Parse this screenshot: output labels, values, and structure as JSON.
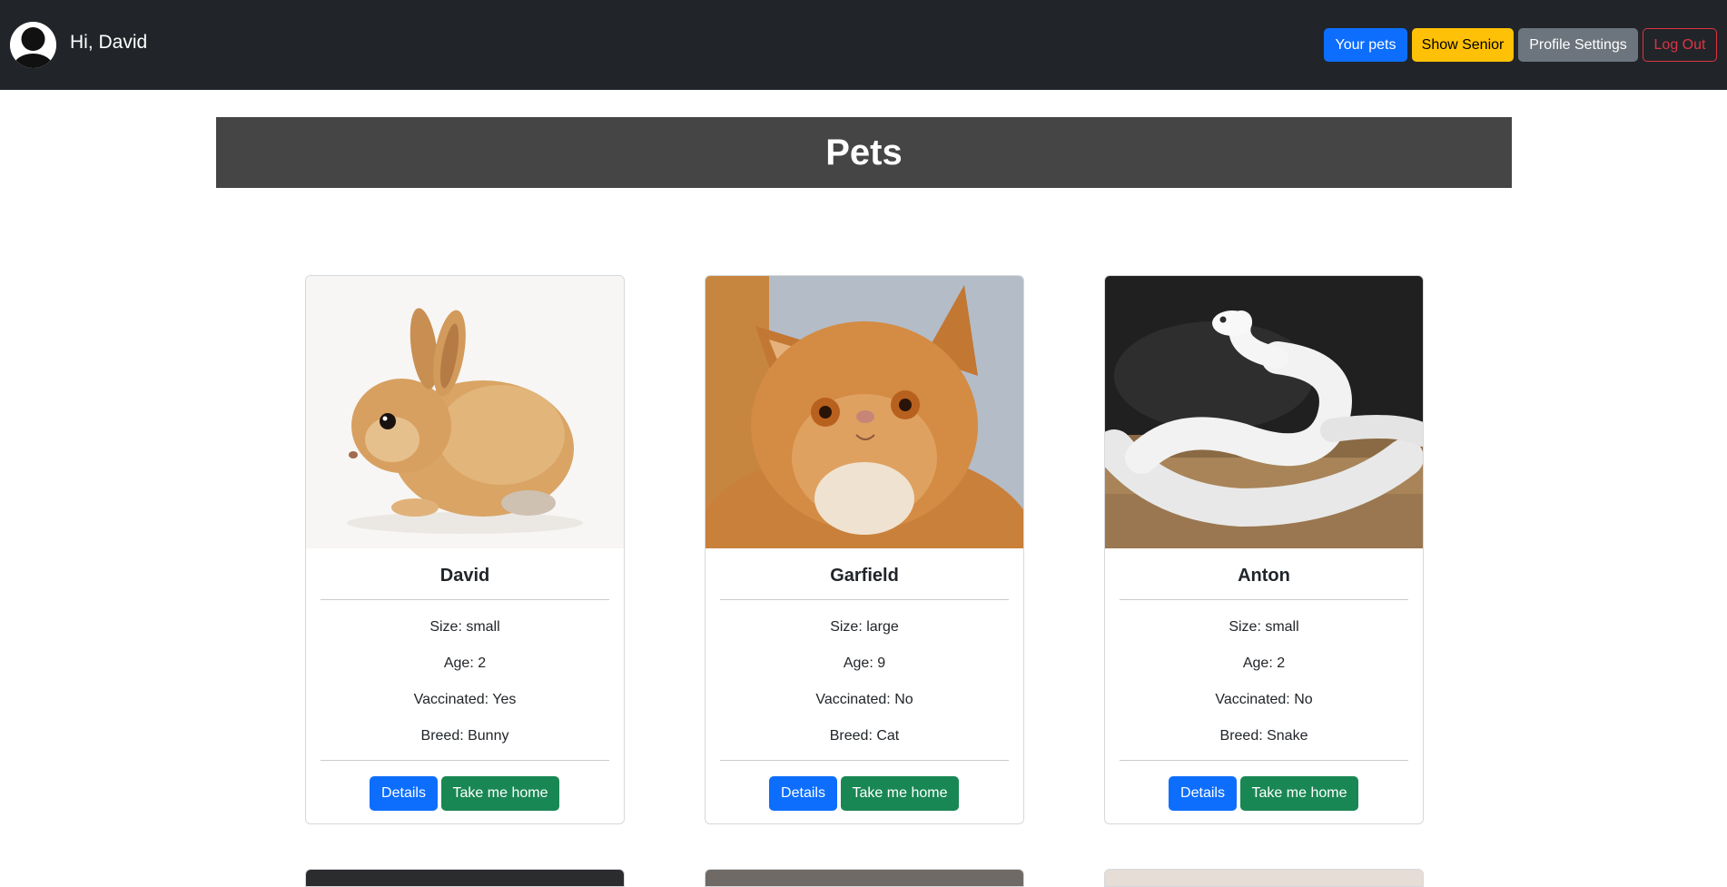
{
  "nav": {
    "greeting": "Hi, David",
    "buttons": {
      "your_pets": "Your pets",
      "show_senior": "Show Senior",
      "profile_settings": "Profile Settings",
      "log_out": "Log Out"
    }
  },
  "banner": {
    "title": "Pets"
  },
  "pets": [
    {
      "name": "David",
      "size": "Size: small",
      "age": "Age: 2",
      "vaccinated": "Vaccinated: Yes",
      "breed": "Breed: Bunny",
      "details_label": "Details",
      "adopt_label": "Take me home"
    },
    {
      "name": "Garfield",
      "size": "Size: large",
      "age": "Age: 9",
      "vaccinated": "Vaccinated: No",
      "breed": "Breed: Cat",
      "details_label": "Details",
      "adopt_label": "Take me home"
    },
    {
      "name": "Anton",
      "size": "Size: small",
      "age": "Age: 2",
      "vaccinated": "Vaccinated: No",
      "breed": "Breed: Snake",
      "details_label": "Details",
      "adopt_label": "Take me home"
    }
  ],
  "colors": {
    "navbar": "#212529",
    "banner": "#454545",
    "primary": "#0d6efd",
    "warning": "#ffc107",
    "secondary": "#6c757d",
    "danger": "#dc3545",
    "success": "#198754"
  },
  "icons": {
    "avatar": "user-avatar-icon"
  }
}
